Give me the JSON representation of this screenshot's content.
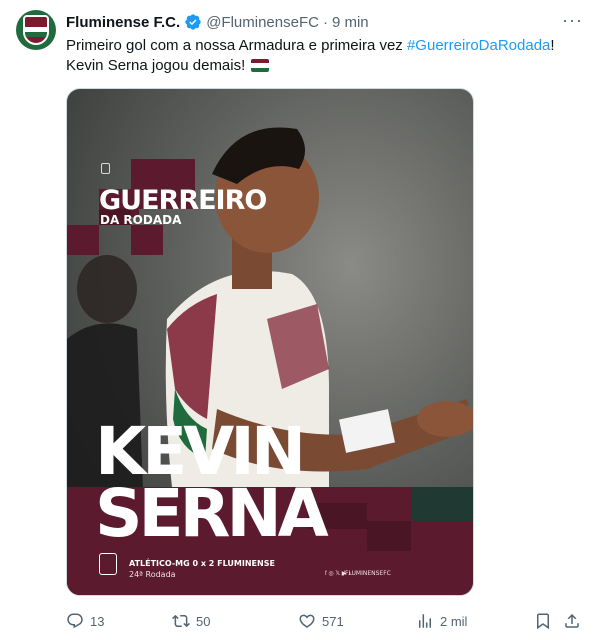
{
  "author": {
    "name": "Fluminense F.C.",
    "handle": "@FluminenseFC",
    "separator": "·",
    "time": "9 min"
  },
  "tweet": {
    "text_part1": "Primeiro gol com a nossa Armadura e primeira vez ",
    "hashtag": "#GuerreiroDaRodada",
    "text_part2": "!",
    "text_line2": "Kevin Serna jogou demais!",
    "flag_colors": [
      "#7a1b2e",
      "#ffffff",
      "#1f6b3d"
    ]
  },
  "media": {
    "title": "GUERREIRO",
    "subtitle": "DA RODADA",
    "player_first": "KEVIN",
    "player_last": "SERNA",
    "match": "ATLÉTICO-MG 0 x 2 FLUMINENSE",
    "round": "24ª Rodada",
    "social_icons": "f ◎ 𝕏 ▶ ♪",
    "social_handle": "/FLUMINENSEFC",
    "brand_color": "#5c1a2e",
    "accent_color": "#7a1b2e"
  },
  "actions": {
    "replies": "13",
    "retweets": "50",
    "likes": "571",
    "views": "2 mil"
  },
  "colors": {
    "link": "#1d9bf0",
    "muted": "#536471",
    "text": "#0f1419"
  }
}
